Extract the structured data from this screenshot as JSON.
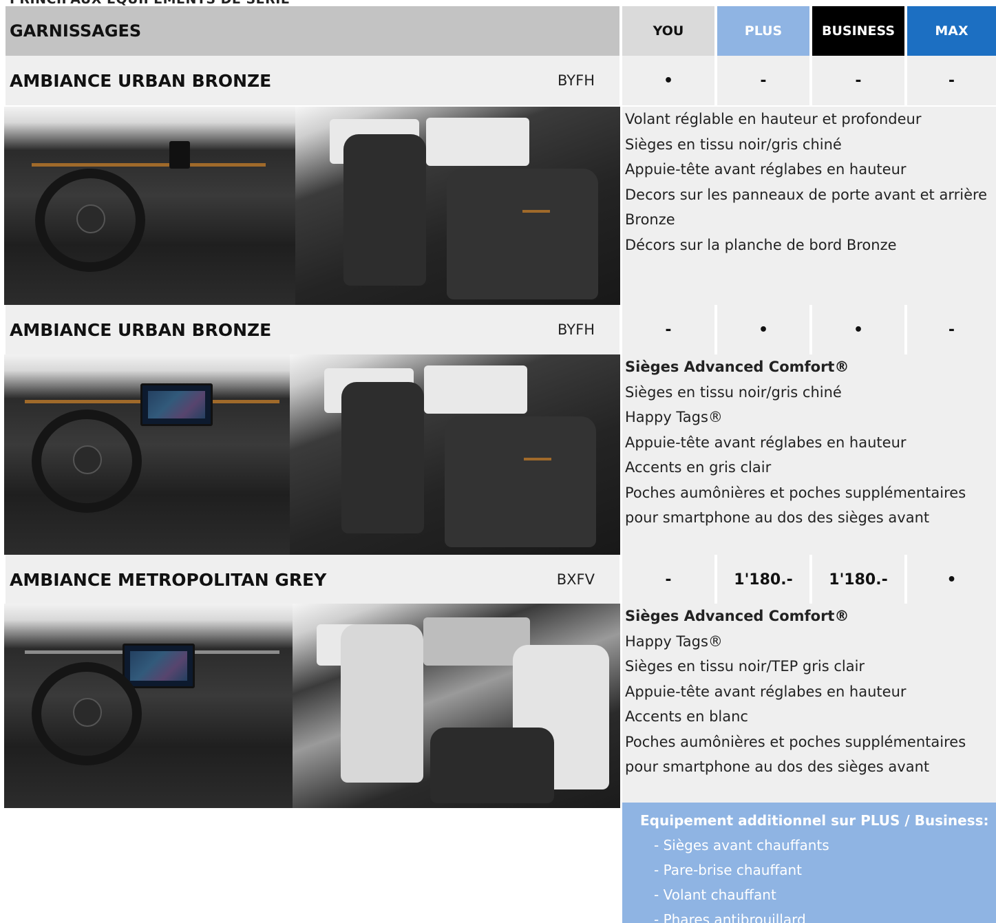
{
  "page": {
    "heading": "PRINCIPAUX ÉQUIPEMENTS DE SÉRIE"
  },
  "header": {
    "title": "GARNISSAGES",
    "trims": [
      {
        "label": "YOU",
        "color": "#dadada"
      },
      {
        "label": "PLUS",
        "color": "#8fb4e3"
      },
      {
        "label": "BUSINESS",
        "color": "#000000"
      },
      {
        "label": "MAX",
        "color": "#1c6fc2"
      }
    ]
  },
  "rows": [
    {
      "name": "AMBIANCE URBAN BRONZE",
      "code": "BYFH",
      "availability": [
        "•",
        "-",
        "-",
        "-"
      ],
      "features": [
        "Volant réglable en hauteur et profondeur",
        "Sièges en tissu noir/gris chiné",
        "Appuie-tête avant réglabes en hauteur",
        "Decors sur les panneaux de porte avant et arrière",
        "Bronze",
        "Décors sur la planche de bord Bronze"
      ]
    },
    {
      "name": "AMBIANCE URBAN BRONZE",
      "code": "BYFH",
      "availability": [
        "-",
        "•",
        "•",
        "-"
      ],
      "features_bold": "Sièges Advanced Comfort®",
      "features": [
        "Sièges en tissu noir/gris chiné",
        "Happy Tags®",
        "Appuie-tête avant réglabes en hauteur",
        "Accents en gris clair",
        "Poches aumônières et poches supplémentaires",
        "pour smartphone au dos des sièges avant"
      ]
    },
    {
      "name": "AMBIANCE METROPOLITAN GREY",
      "code": "BXFV",
      "availability": [
        "-",
        "1'180.-",
        "1'180.-",
        "•"
      ],
      "features_bold": "Sièges Advanced Comfort®",
      "features": [
        "Happy Tags®",
        "Sièges en tissu noir/TEP gris clair",
        "Appuie-tête avant réglabes en hauteur",
        "Accents en blanc",
        "Poches aumônières et poches supplémentaires",
        "pour smartphone au dos des sièges avant"
      ]
    }
  ],
  "addon": {
    "title": "Equipement additionnel sur PLUS / Business:",
    "items": [
      "- Sièges avant chauffants",
      "- Pare-brise chauffant",
      "- Volant chauffant",
      "- Phares antibrouillard"
    ]
  }
}
